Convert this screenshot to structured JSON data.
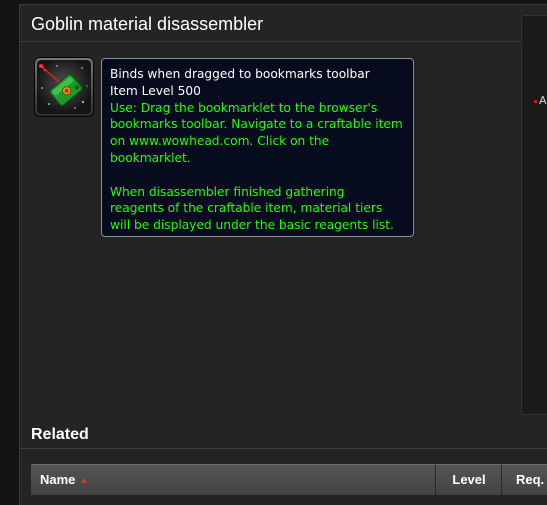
{
  "page": {
    "title": "Goblin material disassembler"
  },
  "item": {
    "icon": "green-device-icon",
    "tooltip": {
      "binding": "Binds when dragged to bookmarks toolbar",
      "item_level": "Item Level 500",
      "use_lines": [
        "Use: Drag the bookmarklet to the browser's",
        "bookmarks toolbar. Navigate to a craftable item",
        "on www.wowhead.com. Click on the",
        "bookmarklet."
      ],
      "note_lines": [
        "When disassembler finished gathering",
        "reagents of the craftable item, material tiers",
        "will be displayed under the basic reagents list."
      ]
    }
  },
  "sidebar": {
    "text": "A"
  },
  "related": {
    "title": "Related",
    "columns": {
      "name": "Name",
      "level": "Level",
      "req": "Req."
    },
    "sort_icon": "sort-ascending-icon"
  },
  "colors": {
    "background": "#242424",
    "tooltip_bg": "#070b1e",
    "tooltip_green": "#1eff00",
    "sort_arrow": "#e03030"
  }
}
